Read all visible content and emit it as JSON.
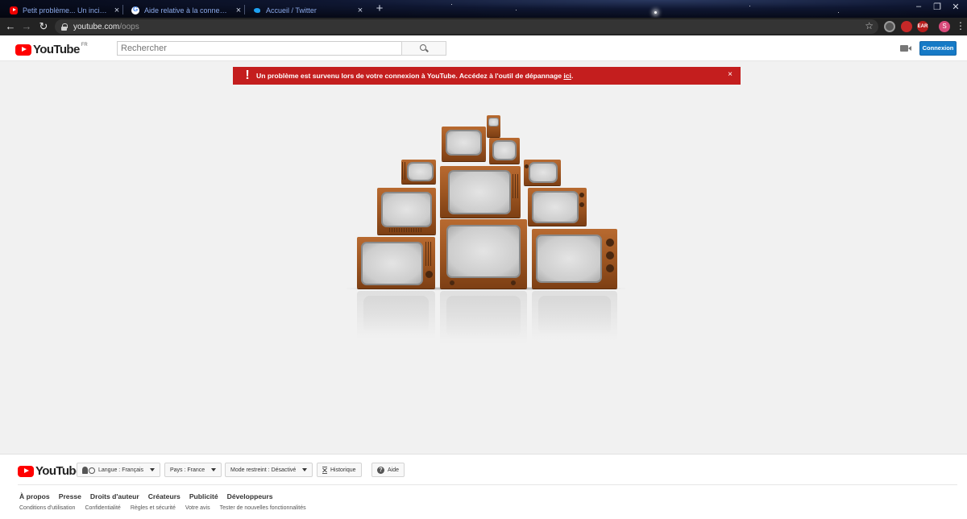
{
  "browser": {
    "tabs": [
      {
        "label": "Petit problème... Un incident est",
        "icon": "youtube-icon"
      },
      {
        "label": "Aide relative à la connexion à YouTube",
        "icon": "google-icon"
      },
      {
        "label": "Accueil / Twitter",
        "icon": "twitter-icon"
      }
    ],
    "new_tab": "+",
    "url_host": "youtube.com",
    "url_path": "/oops",
    "window_controls": {
      "minimize": "–",
      "restore": "❐",
      "close": "✕"
    },
    "extensions": [
      "",
      "",
      "EAR"
    ],
    "profile_initial": "S"
  },
  "youtube": {
    "logo_text": "YouTube",
    "country_code": "FR",
    "search_placeholder": "Rechercher",
    "sign_in": "Connexion"
  },
  "error": {
    "icon": "!",
    "message": "Un problème est survenu lors de votre connexion à YouTube. Accédez à l'outil de dépannage ",
    "link_text": "ici",
    "after_link": ".",
    "close": "×"
  },
  "footer": {
    "logo_text": "YouTube",
    "language": "Langue : Français",
    "country": "Pays : France",
    "restricted": "Mode restreint : Désactivé",
    "history": "Historique",
    "help": "Aide",
    "links_primary": [
      "À propos",
      "Presse",
      "Droits d'auteur",
      "Créateurs",
      "Publicité",
      "Développeurs"
    ],
    "links_secondary": [
      "Conditions d'utilisation",
      "Confidentialité",
      "Règles et sécurité",
      "Votre avis",
      "Tester de nouvelles fonctionnalités"
    ]
  },
  "colors": {
    "error_red": "#c41e1e",
    "signin_blue": "#167ac6",
    "youtube_red": "#ff0000"
  }
}
